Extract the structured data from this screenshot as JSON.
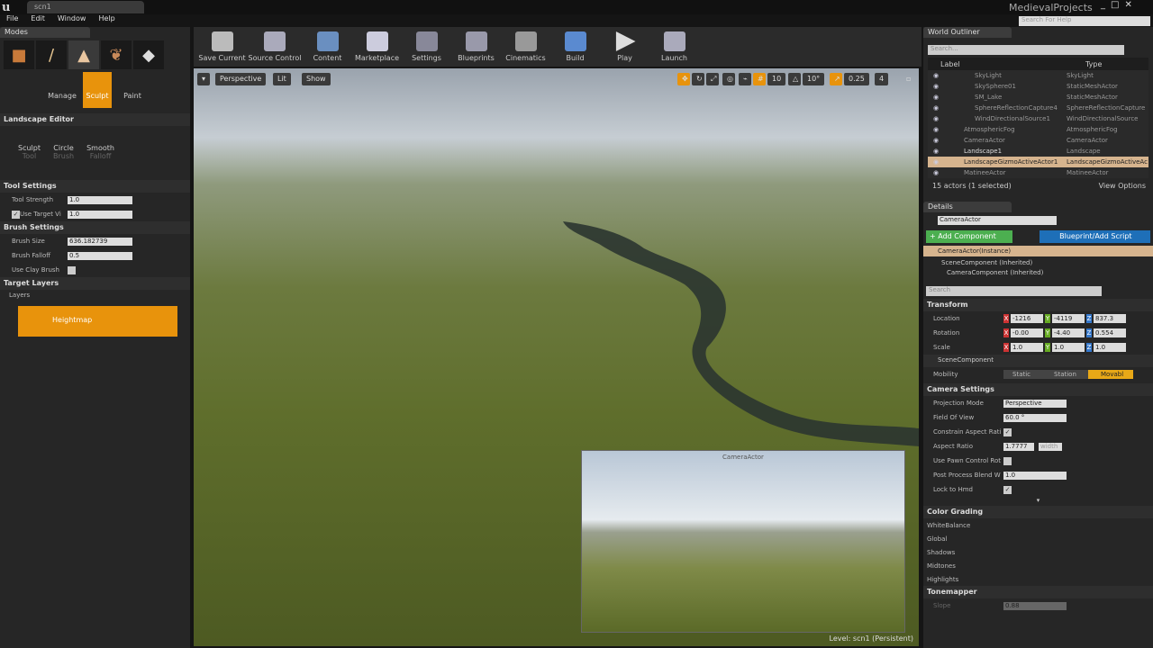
{
  "window": {
    "tab": "scn1",
    "project": "MedievalProjects",
    "help_search_placeholder": "Search For Help",
    "controls": [
      "_",
      "□",
      "✕"
    ]
  },
  "menu": [
    "File",
    "Edit",
    "Window",
    "Help"
  ],
  "modes": {
    "tab": "Modes",
    "mode_icons": [
      "place-icon",
      "paint-icon",
      "landscape-icon",
      "foliage-icon",
      "geometry-icon"
    ],
    "submodes": [
      "Manage",
      "Sculpt",
      "Paint"
    ],
    "active_submode": "Sculpt"
  },
  "landscape_editor": {
    "title": "Landscape Editor",
    "tools": [
      {
        "label": "Sculpt",
        "sub": "Tool"
      },
      {
        "label": "Circle",
        "sub": "Brush"
      },
      {
        "label": "Smooth",
        "sub": "Falloff"
      }
    ]
  },
  "tool_settings": {
    "title": "Tool Settings",
    "tool_strength_label": "Tool Strength",
    "tool_strength": "1.0",
    "use_target_label": "Use Target Vi",
    "use_target": "1.0"
  },
  "brush_settings": {
    "title": "Brush Settings",
    "size_label": "Brush Size",
    "size": "636.182739",
    "falloff_label": "Brush Falloff",
    "falloff": "0.5",
    "clay_label": "Use Clay Brush"
  },
  "target_layers": {
    "title": "Target Layers",
    "layers_label": "Layers",
    "layer": "Heightmap"
  },
  "toolbar": [
    "Save Current",
    "Source Control",
    "Content",
    "Marketplace",
    "Settings",
    "Blueprints",
    "Cinematics",
    "Build",
    "Play",
    "Launch"
  ],
  "viewport": {
    "perspective": "Perspective",
    "lit": "Lit",
    "show": "Show",
    "grid_snap": "10",
    "rot_snap": "10°",
    "scale_snap": "0.25",
    "cam_speed": "4",
    "preview_title": "CameraActor",
    "level": "Level:  scn1 (Persistent)"
  },
  "outliner": {
    "tab": "World Outliner",
    "search_placeholder": "Search...",
    "col_label": "Label",
    "col_type": "Type",
    "rows": [
      {
        "name": "SkyLight",
        "type": "SkyLight"
      },
      {
        "name": "SkySphere01",
        "type": "StaticMeshActor"
      },
      {
        "name": "SM_Lake",
        "type": "StaticMeshActor"
      },
      {
        "name": "SphereReflectionCapture4",
        "type": "SphereReflectionCapture"
      },
      {
        "name": "WindDirectionalSource1",
        "type": "WindDirectionalSource"
      },
      {
        "name": "AtmosphericFog",
        "type": "AtmosphericFog"
      },
      {
        "name": "CameraActor",
        "type": "CameraActor"
      },
      {
        "name": "Landscape1",
        "type": "Landscape"
      },
      {
        "name": "LandscapeGizmoActiveActor1",
        "type": "LandscapeGizmoActiveActor"
      },
      {
        "name": "MatineeActor",
        "type": "MatineeActor"
      }
    ],
    "selected": "LandscapeGizmoActiveActor1",
    "status": "15 actors (1 selected)",
    "view_options": "View Options"
  },
  "details": {
    "tab": "Details",
    "name": "CameraActor",
    "add_component": "+ Add Component",
    "blueprint": "Blueprint/Add Script",
    "instance": "CameraActor(Instance)",
    "components": [
      "SceneComponent (Inherited)",
      "CameraComponent (Inherited)"
    ],
    "search_placeholder": "Search",
    "transform": {
      "title": "Transform",
      "location_label": "Location",
      "location": [
        "-1216",
        "-4119",
        "837.3"
      ],
      "rotation_label": "Rotation",
      "rotation": [
        "-0.00",
        "-4.40",
        "0.554"
      ],
      "scale_label": "Scale",
      "scale": [
        "1.0",
        "1.0",
        "1.0"
      ],
      "scene_component": "SceneComponent",
      "mobility_label": "Mobility",
      "mobility": [
        "Static",
        "Station",
        "Movabl"
      ],
      "mobility_selected": "Movabl"
    },
    "camera": {
      "title": "Camera Settings",
      "projection_label": "Projection Mode",
      "projection": "Perspective",
      "fov_label": "Field Of View",
      "fov": "60.0 °",
      "constrain_label": "Constrain Aspect Rati",
      "aspect_label": "Aspect Ratio",
      "aspect": "1.7777",
      "aspect_axis": "width",
      "pawn_label": "Use Pawn Control Rot",
      "blend_label": "Post Process Blend W",
      "blend": "1.0",
      "hmd_label": "Lock to Hmd"
    },
    "color_grading": {
      "title": "Color Grading",
      "items": [
        "WhiteBalance",
        "Global",
        "Shadows",
        "Midtones",
        "Highlights"
      ]
    },
    "tonemapper": {
      "title": "Tonemapper",
      "slope_label": "Slope",
      "slope": "0.88"
    }
  },
  "colors": {
    "accent": "#e8930c",
    "add_component": "#4caf50",
    "blueprint": "#1e6fb8",
    "selected_row": "#d6b48e"
  }
}
